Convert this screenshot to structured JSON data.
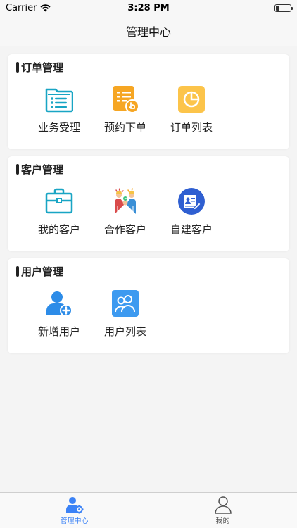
{
  "status_bar": {
    "carrier": "Carrier",
    "time": "3:28 PM"
  },
  "nav": {
    "title": "管理中心"
  },
  "sections": [
    {
      "title": "订单管理",
      "items": [
        {
          "label": "业务受理",
          "icon": "folder-list-icon"
        },
        {
          "label": "预约下单",
          "icon": "order-touch-icon"
        },
        {
          "label": "订单列表",
          "icon": "pie-chart-icon"
        }
      ]
    },
    {
      "title": "客户管理",
      "items": [
        {
          "label": "我的客户",
          "icon": "briefcase-icon"
        },
        {
          "label": "合作客户",
          "icon": "handshake-icon"
        },
        {
          "label": "自建客户",
          "icon": "id-card-icon"
        }
      ]
    },
    {
      "title": "用户管理",
      "items": [
        {
          "label": "新增用户",
          "icon": "add-user-icon"
        },
        {
          "label": "用户列表",
          "icon": "user-group-icon"
        }
      ]
    }
  ],
  "tab_bar": {
    "tabs": [
      {
        "label": "管理中心",
        "icon": "manager-gear-icon",
        "active": true
      },
      {
        "label": "我的",
        "icon": "profile-icon",
        "active": false
      }
    ]
  },
  "colors": {
    "accent": "#3b82f6",
    "orange": "#f6a623",
    "teal": "#19a5c4"
  }
}
